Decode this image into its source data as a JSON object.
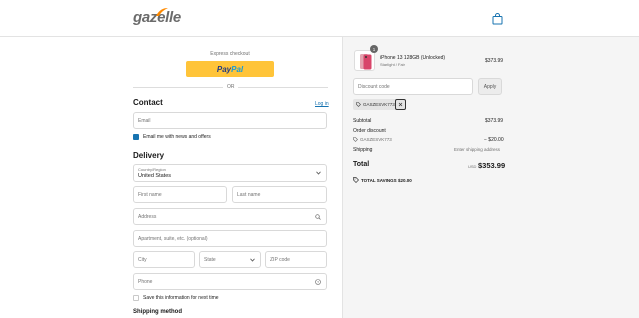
{
  "header": {
    "logo_text": "gazelle",
    "cart_icon": "shopping-bag-icon",
    "accent": "#ff8a00"
  },
  "express": {
    "label": "Express checkout",
    "paypal_label_a": "Pay",
    "paypal_label_b": "Pal",
    "or_label": "OR"
  },
  "contact": {
    "heading": "Contact",
    "login_link": "Log in",
    "email_placeholder": "Email",
    "news_label": "Email me with news and offers",
    "news_checked": true
  },
  "delivery": {
    "heading": "Delivery",
    "country_label": "Country/Region",
    "country_value": "United States",
    "first_name": "First name",
    "last_name": "Last name",
    "address": "Address",
    "apartment": "Apartment, suite, etc. (optional)",
    "city": "City",
    "state": "State",
    "zip": "ZIP code",
    "phone": "Phone",
    "save_info_label": "Save this information for next time",
    "save_info_checked": false
  },
  "shipping_method": {
    "heading": "Shipping method"
  },
  "summary": {
    "quantity": "1",
    "product_name": "iPhone 13 128GB (Unlocked)",
    "product_variant": "Starlight / Fair",
    "product_price": "$373.99",
    "discount_placeholder": "Discount code",
    "apply_label": "Apply",
    "applied_code": "GASZESVK773",
    "subtotal_label": "Subtotal",
    "subtotal_value": "$373.99",
    "order_discount_label": "Order discount",
    "order_discount_code": "GASZESVK773",
    "order_discount_value": "− $20.00",
    "shipping_label": "Shipping",
    "shipping_value": "Enter shipping address",
    "total_label": "Total",
    "total_currency": "USD",
    "total_value": "$353.99",
    "savings_label": "TOTAL SAVINGS",
    "savings_value": "$20.00"
  }
}
